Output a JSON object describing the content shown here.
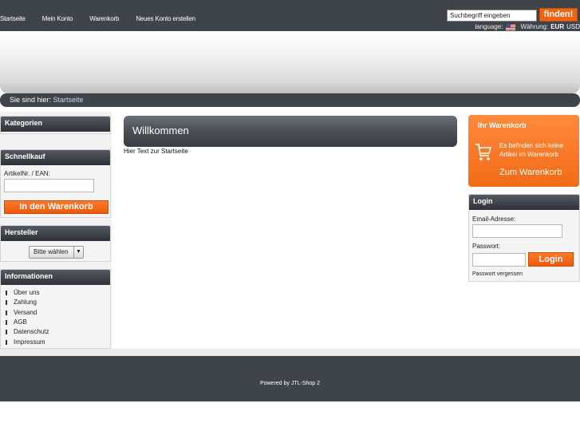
{
  "nav": {
    "items": [
      "Startseite",
      "Mein Konto",
      "Warenkorb",
      "Neues Konto erstellen"
    ]
  },
  "search": {
    "value": "Suchbegriff eingeben",
    "button_label": "finden!"
  },
  "lang": {
    "language_label": "language:",
    "currency_label": "Währung:",
    "currency_active": "EUR",
    "currency_other": "USD"
  },
  "breadcrumb": {
    "prefix": "Sie sind hier:",
    "link": "Startseite"
  },
  "kategorien": {
    "title": "Kategorien"
  },
  "schnellkauf": {
    "title": "Schnellkauf",
    "field_label": "ArtikelNr. / EAN:",
    "button_label": "In den Warenkorb"
  },
  "hersteller": {
    "title": "Hersteller",
    "select_value": "Bitte wählen"
  },
  "informationen": {
    "title": "Informationen",
    "items": [
      "Über uns",
      "Zahlung",
      "Versand",
      "AGB",
      "Datenschutz",
      "Impressum"
    ]
  },
  "main": {
    "heading": "Willkommen",
    "text": "Hier Text zur Startseite"
  },
  "cart": {
    "title": "Ihr Warenkorb",
    "message_line1": "Es befinden sich keine",
    "message_line2": "Artikel im Warenkorb",
    "link": "Zum Warenkorb"
  },
  "login": {
    "title": "Login",
    "email_label": "Email-Adresse:",
    "password_label": "Passwort:",
    "button_label": "Login",
    "forgot_link": "Passwort vergessen"
  },
  "footer": {
    "text": "Powered by JTL-Shop 2"
  },
  "colors": {
    "dark": "#3f434a",
    "accent": "#ee6314"
  }
}
